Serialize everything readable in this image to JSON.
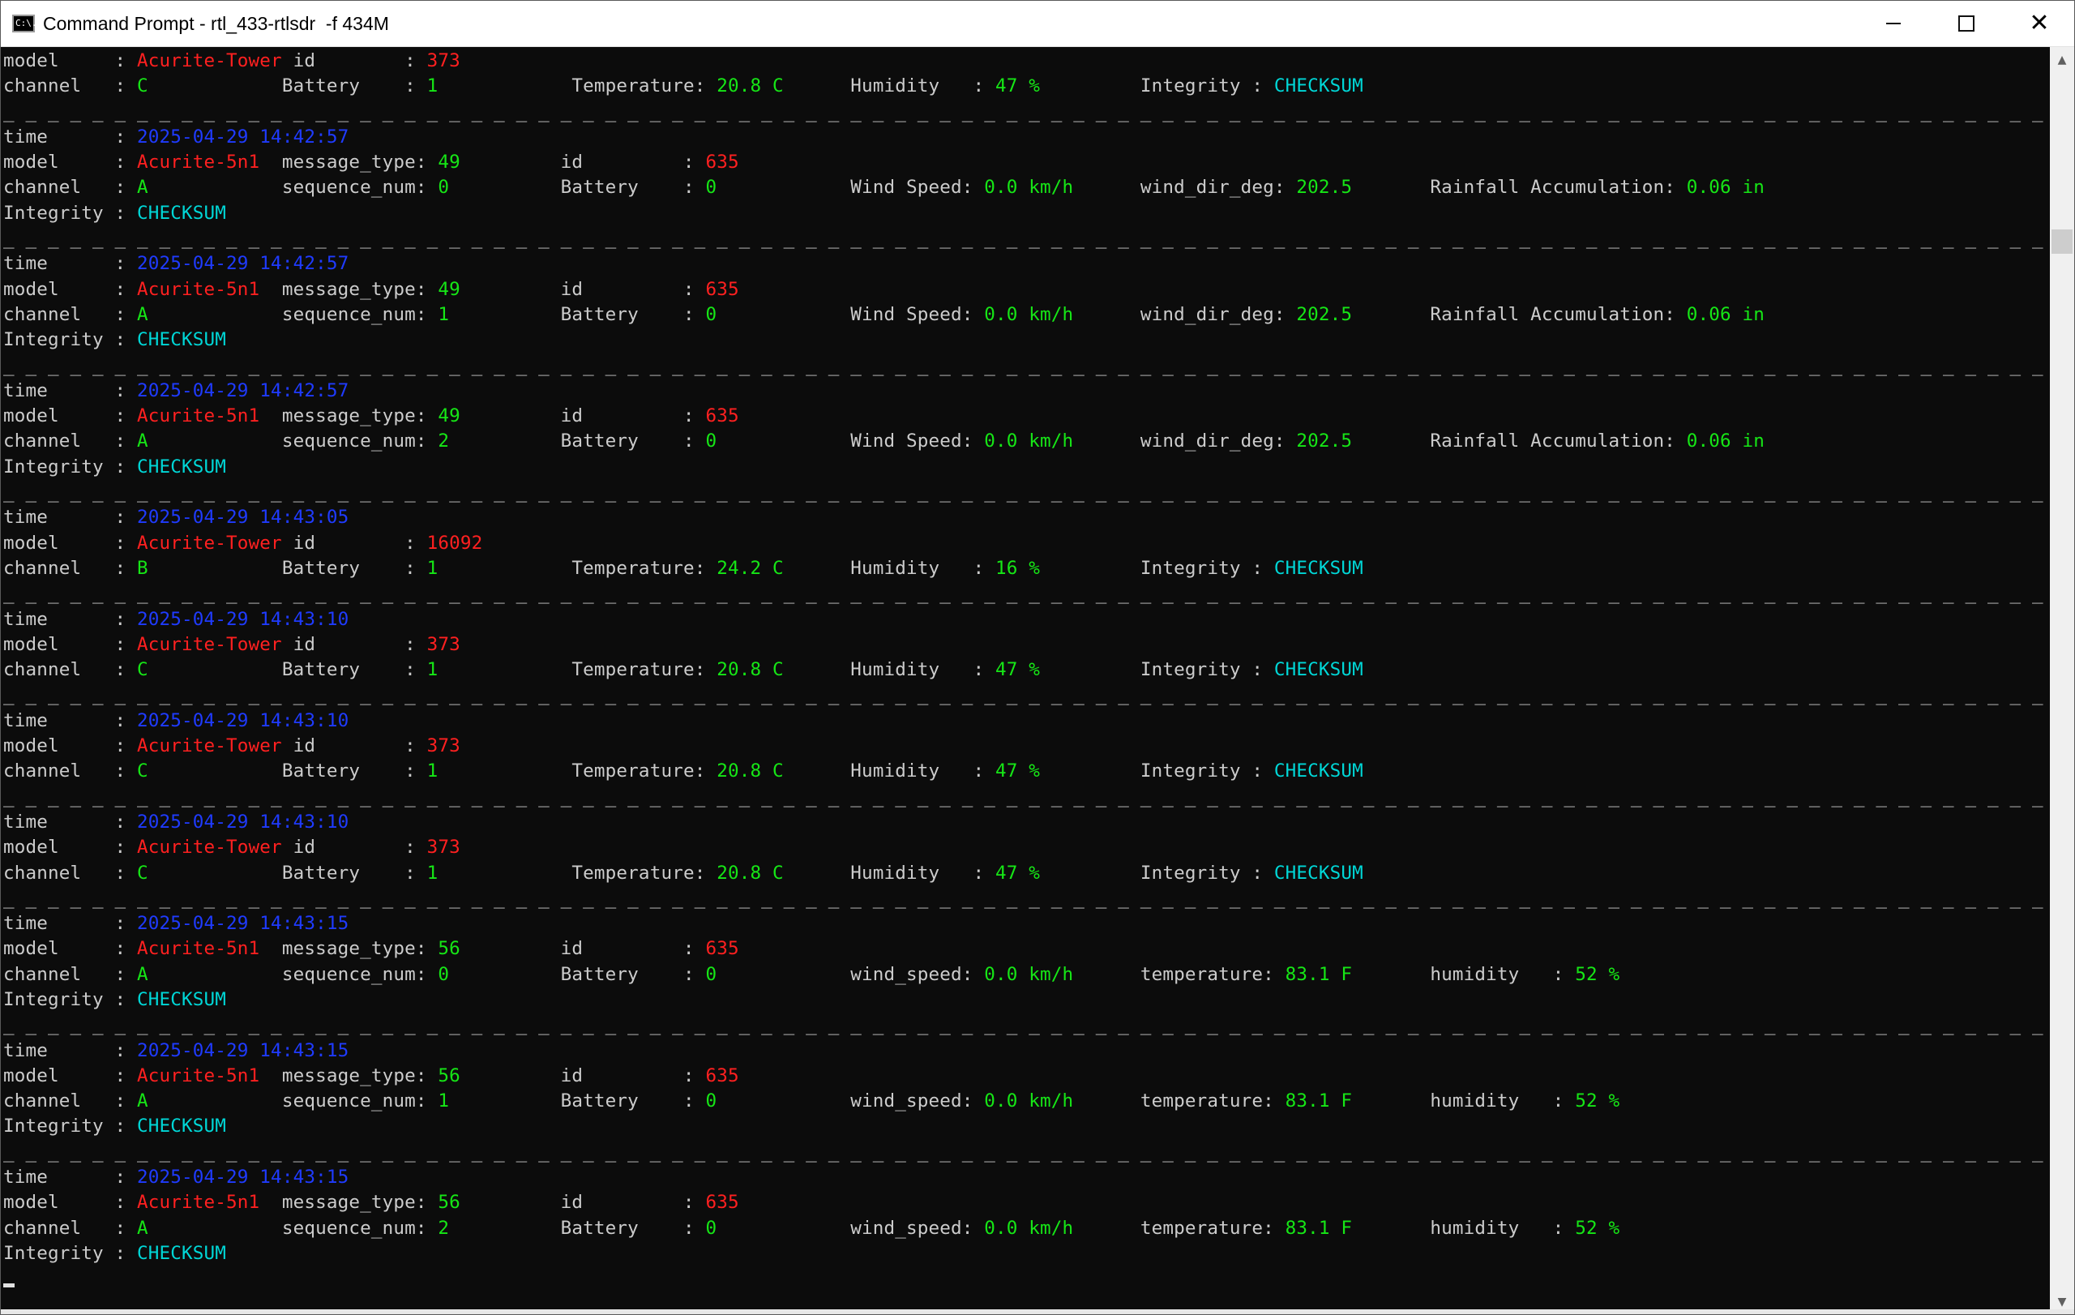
{
  "window": {
    "title": "Command Prompt - rtl_433-rtlsdr  -f 434M",
    "icon": "cmd-icon",
    "icon_text": "C:\\.",
    "controls": {
      "minimize": "minimize-icon",
      "maximize": "maximize-icon",
      "close": "✕"
    }
  },
  "colors": {
    "background": "#0c0c0c",
    "label": "#cccccc",
    "time": "#1f3bff",
    "model": "#ff2020",
    "value": "#16e616",
    "integrity": "#00d7d7"
  },
  "separator": "_ _ _ _ _ _ _ _ _ _ _ _ _ _ _ _ _ _ _ _ _ _ _ _ _ _ _ _ _ _ _ _ _ _ _ _ _ _ _ _ _ _ _ _ _ _ _ _ _ _ _ _ _ _ _ _ _ _ _ _ _ _ _ _ _ _ _ _ _ _ _ _ _ _ _ _ _ _ _ _ _ _ _ _ _ _ _ _ _ _ _ _ _ _ _ _ _ _ _ _ _ _ _ _ _ _ _ _ _ _ _ _ _ _ _ _ _ _ _ _ _ _ _ _ _ _ _ _ _ _ _ _ _ _ _ _ _ _ _ _ _ _ _ _ _ _ _ _ _ _ _ _ _ _ _ _ _ _ _ _ _ _ _ _ _ _ _ _ _ _ _ _ _ _ _",
  "lines": [
    [
      [
        "model     : ",
        "lbl"
      ],
      [
        "Acurite-Tower",
        "red"
      ],
      [
        " id        : ",
        "lbl"
      ],
      [
        "373",
        "red"
      ]
    ],
    [
      [
        "channel   : ",
        "lbl"
      ],
      [
        "C",
        "grn"
      ],
      [
        "            Battery    : ",
        "lbl"
      ],
      [
        "1",
        "grn"
      ],
      [
        "            Temperature: ",
        "lbl"
      ],
      [
        "20.8 C",
        "grn"
      ],
      [
        "      Humidity   : ",
        "lbl"
      ],
      [
        "47 %",
        "grn"
      ],
      [
        "         Integrity : ",
        "lbl"
      ],
      [
        "CHECKSUM",
        "cyn"
      ]
    ],
    "SEP",
    [
      [
        "time      : ",
        "lbl"
      ],
      [
        "2025-04-29 14:42:57",
        "time"
      ]
    ],
    [
      [
        "model     : ",
        "lbl"
      ],
      [
        "Acurite-5n1",
        "red"
      ],
      [
        "  message_type: ",
        "lbl"
      ],
      [
        "49",
        "grn"
      ],
      [
        "         id         : ",
        "lbl"
      ],
      [
        "635",
        "red"
      ]
    ],
    [
      [
        "channel   : ",
        "lbl"
      ],
      [
        "A",
        "grn"
      ],
      [
        "            sequence_num: ",
        "lbl"
      ],
      [
        "0",
        "grn"
      ],
      [
        "          Battery    : ",
        "lbl"
      ],
      [
        "0",
        "grn"
      ],
      [
        "            Wind Speed: ",
        "lbl"
      ],
      [
        "0.0 km/h",
        "grn"
      ],
      [
        "      wind_dir_deg: ",
        "lbl"
      ],
      [
        "202.5",
        "grn"
      ],
      [
        "       Rainfall Accumulation: ",
        "lbl"
      ],
      [
        "0.06 in",
        "grn"
      ]
    ],
    [
      [
        "Integrity : ",
        "lbl"
      ],
      [
        "CHECKSUM",
        "cyn"
      ]
    ],
    "SEP",
    [
      [
        "time      : ",
        "lbl"
      ],
      [
        "2025-04-29 14:42:57",
        "time"
      ]
    ],
    [
      [
        "model     : ",
        "lbl"
      ],
      [
        "Acurite-5n1",
        "red"
      ],
      [
        "  message_type: ",
        "lbl"
      ],
      [
        "49",
        "grn"
      ],
      [
        "         id         : ",
        "lbl"
      ],
      [
        "635",
        "red"
      ]
    ],
    [
      [
        "channel   : ",
        "lbl"
      ],
      [
        "A",
        "grn"
      ],
      [
        "            sequence_num: ",
        "lbl"
      ],
      [
        "1",
        "grn"
      ],
      [
        "          Battery    : ",
        "lbl"
      ],
      [
        "0",
        "grn"
      ],
      [
        "            Wind Speed: ",
        "lbl"
      ],
      [
        "0.0 km/h",
        "grn"
      ],
      [
        "      wind_dir_deg: ",
        "lbl"
      ],
      [
        "202.5",
        "grn"
      ],
      [
        "       Rainfall Accumulation: ",
        "lbl"
      ],
      [
        "0.06 in",
        "grn"
      ]
    ],
    [
      [
        "Integrity : ",
        "lbl"
      ],
      [
        "CHECKSUM",
        "cyn"
      ]
    ],
    "SEP",
    [
      [
        "time      : ",
        "lbl"
      ],
      [
        "2025-04-29 14:42:57",
        "time"
      ]
    ],
    [
      [
        "model     : ",
        "lbl"
      ],
      [
        "Acurite-5n1",
        "red"
      ],
      [
        "  message_type: ",
        "lbl"
      ],
      [
        "49",
        "grn"
      ],
      [
        "         id         : ",
        "lbl"
      ],
      [
        "635",
        "red"
      ]
    ],
    [
      [
        "channel   : ",
        "lbl"
      ],
      [
        "A",
        "grn"
      ],
      [
        "            sequence_num: ",
        "lbl"
      ],
      [
        "2",
        "grn"
      ],
      [
        "          Battery    : ",
        "lbl"
      ],
      [
        "0",
        "grn"
      ],
      [
        "            Wind Speed: ",
        "lbl"
      ],
      [
        "0.0 km/h",
        "grn"
      ],
      [
        "      wind_dir_deg: ",
        "lbl"
      ],
      [
        "202.5",
        "grn"
      ],
      [
        "       Rainfall Accumulation: ",
        "lbl"
      ],
      [
        "0.06 in",
        "grn"
      ]
    ],
    [
      [
        "Integrity : ",
        "lbl"
      ],
      [
        "CHECKSUM",
        "cyn"
      ]
    ],
    "SEP",
    [
      [
        "time      : ",
        "lbl"
      ],
      [
        "2025-04-29 14:43:05",
        "time"
      ]
    ],
    [
      [
        "model     : ",
        "lbl"
      ],
      [
        "Acurite-Tower",
        "red"
      ],
      [
        " id        : ",
        "lbl"
      ],
      [
        "16092",
        "red"
      ]
    ],
    [
      [
        "channel   : ",
        "lbl"
      ],
      [
        "B",
        "grn"
      ],
      [
        "            Battery    : ",
        "lbl"
      ],
      [
        "1",
        "grn"
      ],
      [
        "            Temperature: ",
        "lbl"
      ],
      [
        "24.2 C",
        "grn"
      ],
      [
        "      Humidity   : ",
        "lbl"
      ],
      [
        "16 %",
        "grn"
      ],
      [
        "         Integrity : ",
        "lbl"
      ],
      [
        "CHECKSUM",
        "cyn"
      ]
    ],
    "SEP",
    [
      [
        "time      : ",
        "lbl"
      ],
      [
        "2025-04-29 14:43:10",
        "time"
      ]
    ],
    [
      [
        "model     : ",
        "lbl"
      ],
      [
        "Acurite-Tower",
        "red"
      ],
      [
        " id        : ",
        "lbl"
      ],
      [
        "373",
        "red"
      ]
    ],
    [
      [
        "channel   : ",
        "lbl"
      ],
      [
        "C",
        "grn"
      ],
      [
        "            Battery    : ",
        "lbl"
      ],
      [
        "1",
        "grn"
      ],
      [
        "            Temperature: ",
        "lbl"
      ],
      [
        "20.8 C",
        "grn"
      ],
      [
        "      Humidity   : ",
        "lbl"
      ],
      [
        "47 %",
        "grn"
      ],
      [
        "         Integrity : ",
        "lbl"
      ],
      [
        "CHECKSUM",
        "cyn"
      ]
    ],
    "SEP",
    [
      [
        "time      : ",
        "lbl"
      ],
      [
        "2025-04-29 14:43:10",
        "time"
      ]
    ],
    [
      [
        "model     : ",
        "lbl"
      ],
      [
        "Acurite-Tower",
        "red"
      ],
      [
        " id        : ",
        "lbl"
      ],
      [
        "373",
        "red"
      ]
    ],
    [
      [
        "channel   : ",
        "lbl"
      ],
      [
        "C",
        "grn"
      ],
      [
        "            Battery    : ",
        "lbl"
      ],
      [
        "1",
        "grn"
      ],
      [
        "            Temperature: ",
        "lbl"
      ],
      [
        "20.8 C",
        "grn"
      ],
      [
        "      Humidity   : ",
        "lbl"
      ],
      [
        "47 %",
        "grn"
      ],
      [
        "         Integrity : ",
        "lbl"
      ],
      [
        "CHECKSUM",
        "cyn"
      ]
    ],
    "SEP",
    [
      [
        "time      : ",
        "lbl"
      ],
      [
        "2025-04-29 14:43:10",
        "time"
      ]
    ],
    [
      [
        "model     : ",
        "lbl"
      ],
      [
        "Acurite-Tower",
        "red"
      ],
      [
        " id        : ",
        "lbl"
      ],
      [
        "373",
        "red"
      ]
    ],
    [
      [
        "channel   : ",
        "lbl"
      ],
      [
        "C",
        "grn"
      ],
      [
        "            Battery    : ",
        "lbl"
      ],
      [
        "1",
        "grn"
      ],
      [
        "            Temperature: ",
        "lbl"
      ],
      [
        "20.8 C",
        "grn"
      ],
      [
        "      Humidity   : ",
        "lbl"
      ],
      [
        "47 %",
        "grn"
      ],
      [
        "         Integrity : ",
        "lbl"
      ],
      [
        "CHECKSUM",
        "cyn"
      ]
    ],
    "SEP",
    [
      [
        "time      : ",
        "lbl"
      ],
      [
        "2025-04-29 14:43:15",
        "time"
      ]
    ],
    [
      [
        "model     : ",
        "lbl"
      ],
      [
        "Acurite-5n1",
        "red"
      ],
      [
        "  message_type: ",
        "lbl"
      ],
      [
        "56",
        "grn"
      ],
      [
        "         id         : ",
        "lbl"
      ],
      [
        "635",
        "red"
      ]
    ],
    [
      [
        "channel   : ",
        "lbl"
      ],
      [
        "A",
        "grn"
      ],
      [
        "            sequence_num: ",
        "lbl"
      ],
      [
        "0",
        "grn"
      ],
      [
        "          Battery    : ",
        "lbl"
      ],
      [
        "0",
        "grn"
      ],
      [
        "            wind_speed: ",
        "lbl"
      ],
      [
        "0.0 km/h",
        "grn"
      ],
      [
        "      temperature: ",
        "lbl"
      ],
      [
        "83.1 F",
        "grn"
      ],
      [
        "       humidity   : ",
        "lbl"
      ],
      [
        "52 %",
        "grn"
      ]
    ],
    [
      [
        "Integrity : ",
        "lbl"
      ],
      [
        "CHECKSUM",
        "cyn"
      ]
    ],
    "SEP",
    [
      [
        "time      : ",
        "lbl"
      ],
      [
        "2025-04-29 14:43:15",
        "time"
      ]
    ],
    [
      [
        "model     : ",
        "lbl"
      ],
      [
        "Acurite-5n1",
        "red"
      ],
      [
        "  message_type: ",
        "lbl"
      ],
      [
        "56",
        "grn"
      ],
      [
        "         id         : ",
        "lbl"
      ],
      [
        "635",
        "red"
      ]
    ],
    [
      [
        "channel   : ",
        "lbl"
      ],
      [
        "A",
        "grn"
      ],
      [
        "            sequence_num: ",
        "lbl"
      ],
      [
        "1",
        "grn"
      ],
      [
        "          Battery    : ",
        "lbl"
      ],
      [
        "0",
        "grn"
      ],
      [
        "            wind_speed: ",
        "lbl"
      ],
      [
        "0.0 km/h",
        "grn"
      ],
      [
        "      temperature: ",
        "lbl"
      ],
      [
        "83.1 F",
        "grn"
      ],
      [
        "       humidity   : ",
        "lbl"
      ],
      [
        "52 %",
        "grn"
      ]
    ],
    [
      [
        "Integrity : ",
        "lbl"
      ],
      [
        "CHECKSUM",
        "cyn"
      ]
    ],
    "SEP",
    [
      [
        "time      : ",
        "lbl"
      ],
      [
        "2025-04-29 14:43:15",
        "time"
      ]
    ],
    [
      [
        "model     : ",
        "lbl"
      ],
      [
        "Acurite-5n1",
        "red"
      ],
      [
        "  message_type: ",
        "lbl"
      ],
      [
        "56",
        "grn"
      ],
      [
        "         id         : ",
        "lbl"
      ],
      [
        "635",
        "red"
      ]
    ],
    [
      [
        "channel   : ",
        "lbl"
      ],
      [
        "A",
        "grn"
      ],
      [
        "            sequence_num: ",
        "lbl"
      ],
      [
        "2",
        "grn"
      ],
      [
        "          Battery    : ",
        "lbl"
      ],
      [
        "0",
        "grn"
      ],
      [
        "            wind_speed: ",
        "lbl"
      ],
      [
        "0.0 km/h",
        "grn"
      ],
      [
        "      temperature: ",
        "lbl"
      ],
      [
        "83.1 F",
        "grn"
      ],
      [
        "       humidity   : ",
        "lbl"
      ],
      [
        "52 %",
        "grn"
      ]
    ],
    [
      [
        "Integrity : ",
        "lbl"
      ],
      [
        "CHECKSUM",
        "cyn"
      ]
    ],
    "CURSOR"
  ],
  "scrollbar": {
    "up": "▲",
    "down": "▼",
    "up_icon": "scroll-up-icon",
    "down_icon": "scroll-down-icon"
  }
}
